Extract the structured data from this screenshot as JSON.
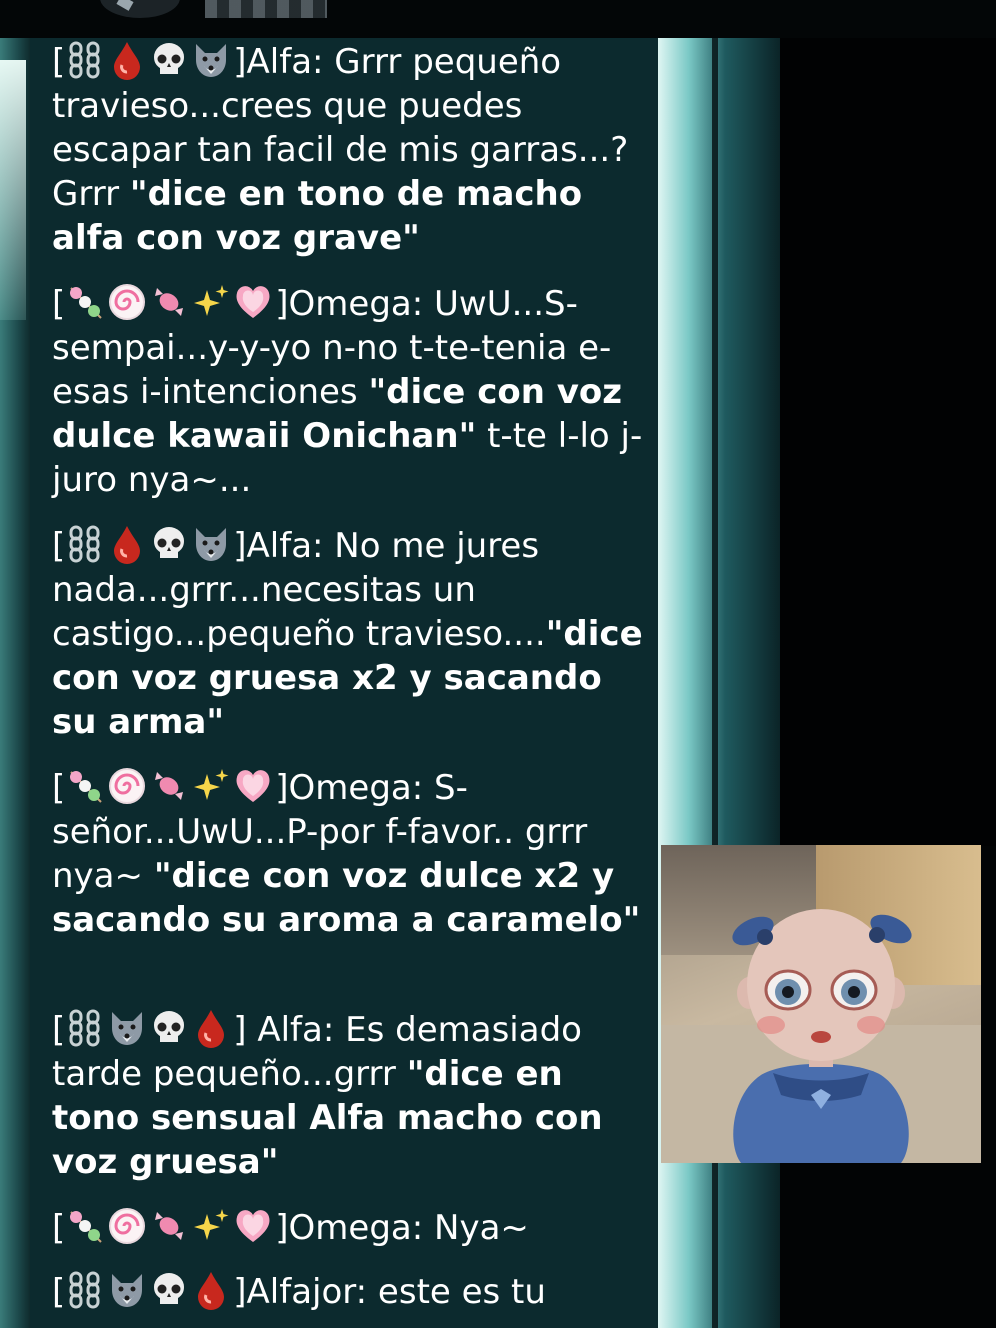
{
  "header": {
    "contact_name_blurred": ""
  },
  "messages": [
    {
      "icons": [
        "chains-icon",
        "blood-drop-icon",
        "skull-icon",
        "wolf-icon"
      ],
      "sender": "]Alfa:",
      "text_plain": " Grrr pequeño travieso...crees que puedes escapar tan facil de mis garras...? Grrr ",
      "text_bold": "\"dice en tono de macho alfa con voz grave\""
    },
    {
      "icons": [
        "candy-skewer-icon",
        "fish-cake-icon",
        "candy-icon",
        "sparkles-icon",
        "glowing-heart-icon"
      ],
      "sender": "]Omega:",
      "text_plain": " UwU...S-sempai...y-y-yo n-no t-te-tenia e-esas i-intenciones ",
      "text_bold": "\"dice con voz dulce kawaii Onichan\"",
      "text_after": " t-te l-lo j-juro nya~..."
    },
    {
      "icons": [
        "chains-icon",
        "blood-drop-icon",
        "skull-icon",
        "wolf-icon"
      ],
      "sender": "]Alfa:",
      "text_plain": " No me jures nada...grrr...necesitas un castigo...pequeño travieso....",
      "text_bold": "\"dice con voz gruesa x2 y sacando su arma\""
    },
    {
      "icons": [
        "candy-skewer-icon",
        "fish-cake-icon",
        "candy-icon",
        "sparkles-icon",
        "glowing-heart-icon"
      ],
      "sender": "]Omega:",
      "text_plain": " S-señor...UwU...P-por f-favor.. grrr nya~ ",
      "text_bold": "\"dice con voz dulce x2 y sacando su aroma a caramelo\""
    },
    {
      "icons": [
        "chains-icon",
        "wolf-icon",
        "skull-icon",
        "blood-drop-icon"
      ],
      "sender": "] Alfa:",
      "text_plain": " Es demasiado tarde pequeño...grrr ",
      "text_bold": "\"dice en tono sensual Alfa macho con voz gruesa\""
    },
    {
      "icons": [
        "candy-skewer-icon",
        "fish-cake-icon",
        "candy-icon",
        "sparkles-icon",
        "glowing-heart-icon"
      ],
      "sender": "]Omega:",
      "text_plain": " Nya~"
    },
    {
      "icons": [
        "chains-icon",
        "wolf-icon",
        "skull-icon",
        "blood-drop-icon"
      ],
      "sender": "]Alfajor:",
      "text_plain": " este es tu"
    }
  ],
  "sticker": {
    "subject": "doll-sticker"
  }
}
